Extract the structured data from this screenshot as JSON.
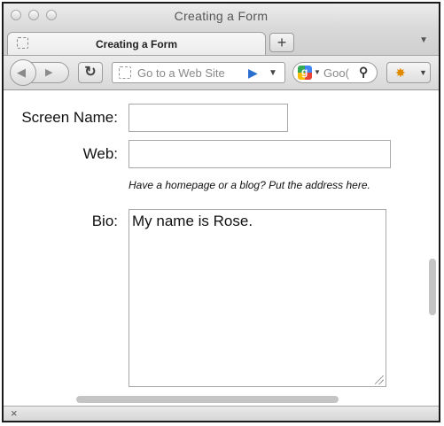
{
  "window": {
    "title": "Creating a Form"
  },
  "tabs": [
    {
      "label": "Creating a Form",
      "active": true
    }
  ],
  "toolbar": {
    "new_tab_label": "+",
    "reload_icon": "reload-icon",
    "url_placeholder": "Go to a Web Site",
    "search_placeholder": "Goo(",
    "search_engine_icon": "google-icon"
  },
  "form": {
    "screen_name": {
      "label": "Screen Name:",
      "value": ""
    },
    "web": {
      "label": "Web:",
      "value": "",
      "hint": "Have a homepage or a blog? Put the address here."
    },
    "bio": {
      "label": "Bio:",
      "value": "My name is Rose."
    }
  },
  "colors": {
    "accent": "#2a6fd0"
  }
}
